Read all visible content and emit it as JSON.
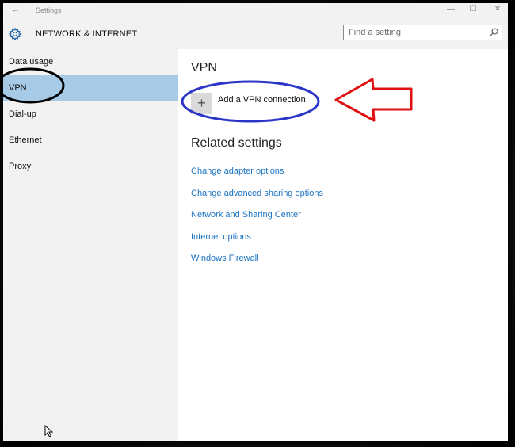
{
  "window": {
    "title": "Settings",
    "controls": {
      "back": "←",
      "minimize": "—",
      "maximize": "☐",
      "close": "✕"
    }
  },
  "header": {
    "title": "NETWORK & INTERNET",
    "icon": "gear-icon"
  },
  "search": {
    "placeholder": "Find a setting",
    "value": "",
    "icon": "search-icon"
  },
  "sidebar": {
    "items": [
      {
        "label": "Data usage",
        "selected": false
      },
      {
        "label": "VPN",
        "selected": true
      },
      {
        "label": "Dial-up",
        "selected": false
      },
      {
        "label": "Ethernet",
        "selected": false
      },
      {
        "label": "Proxy",
        "selected": false
      }
    ]
  },
  "main": {
    "section_title": "VPN",
    "add_vpn": {
      "icon_glyph": "+",
      "label": "Add a VPN connection"
    },
    "related_title": "Related settings",
    "related_links": [
      "Change adapter options",
      "Change advanced sharing options",
      "Network and Sharing Center",
      "Internet options",
      "Windows Firewall"
    ]
  },
  "colors": {
    "accent_selected": "#a7cbe7",
    "link": "#1a73c2",
    "sidebar_bg": "#f2f2f2",
    "annotation_black": "#000000",
    "annotation_blue": "#2b36c8",
    "annotation_red": "#e01010"
  }
}
